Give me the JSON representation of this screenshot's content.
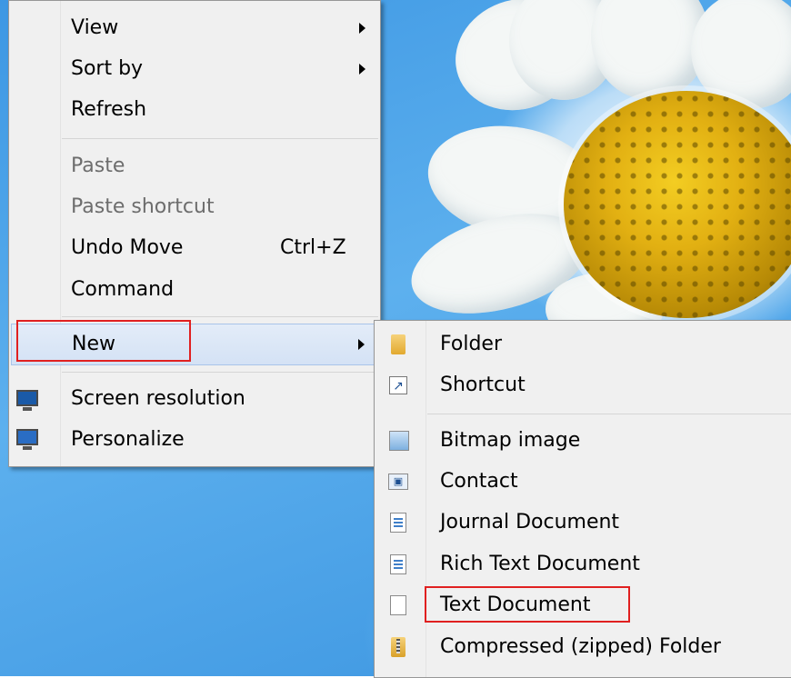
{
  "main_menu": {
    "items": [
      {
        "label": "View",
        "has_submenu": true
      },
      {
        "label": "Sort by",
        "has_submenu": true
      },
      {
        "label": "Refresh"
      },
      {
        "label": "Paste",
        "disabled": true
      },
      {
        "label": "Paste shortcut",
        "disabled": true
      },
      {
        "label": "Undo Move",
        "shortcut": "Ctrl+Z"
      },
      {
        "label": "Command"
      },
      {
        "label": "New",
        "has_submenu": true,
        "highlighted": true
      },
      {
        "label": "Screen resolution",
        "icon": "screen-resolution-icon"
      },
      {
        "label": "Personalize",
        "icon": "personalize-icon"
      }
    ]
  },
  "new_submenu": {
    "items": [
      {
        "label": "Folder",
        "icon": "folder-icon"
      },
      {
        "label": "Shortcut",
        "icon": "shortcut-icon"
      },
      {
        "label": "Bitmap image",
        "icon": "bitmap-icon"
      },
      {
        "label": "Contact",
        "icon": "contact-icon"
      },
      {
        "label": "Journal Document",
        "icon": "journal-icon"
      },
      {
        "label": "Rich Text Document",
        "icon": "rich-text-icon"
      },
      {
        "label": "Text Document",
        "icon": "text-document-icon",
        "annotated": true
      },
      {
        "label": "Compressed (zipped) Folder",
        "icon": "zip-folder-icon"
      }
    ]
  },
  "colors": {
    "annotation": "#e02020",
    "menu_bg": "#f0f0f0",
    "desktop_blue": "#3d97e3",
    "flower_yellow": "#e2b012"
  }
}
